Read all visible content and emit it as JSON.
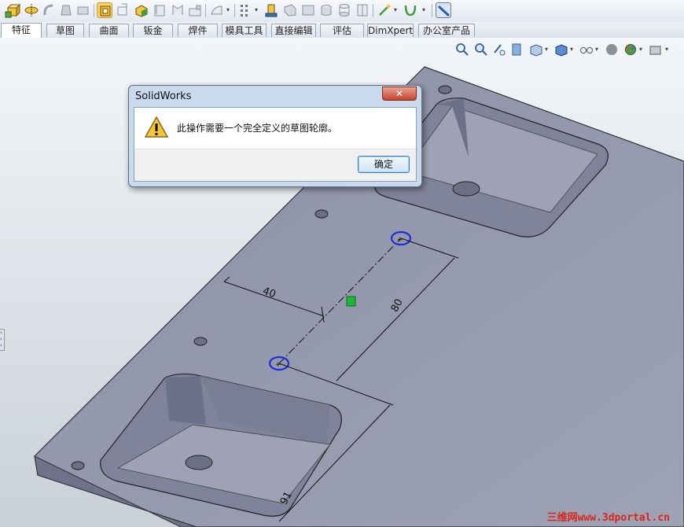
{
  "toolbar": {
    "icons": [
      "extruded-boss-icon",
      "revolve-icon",
      "swept-icon",
      "lofted-icon",
      "boundary-icon",
      "sketch-icon",
      "smart-dimension-icon",
      "3d-sketch-icon",
      "feature-icon",
      "shell-icon",
      "rib-icon",
      "draft-icon",
      "fillet-icon",
      "chamfer-icon",
      "hole-wizard-icon",
      "pattern-icon",
      "reference-geometry-icon",
      "curves-icon",
      "instant3d-icon"
    ]
  },
  "tabs": [
    "特征",
    "草图",
    "曲面",
    "钣金",
    "焊件",
    "模具工具",
    "直接编辑",
    "评估",
    "DimXpert",
    "办公室产品"
  ],
  "active_tab": "特征",
  "dialog": {
    "title": "SolidWorks",
    "close_symbol": "✕",
    "message": "此操作需要一个完全定义的草图轮廓。",
    "ok_label": "确定"
  },
  "sketch": {
    "dim_40": "40",
    "dim_80": "80",
    "dim_91": "91"
  },
  "watermark": "三维网www.3dportal.cn"
}
